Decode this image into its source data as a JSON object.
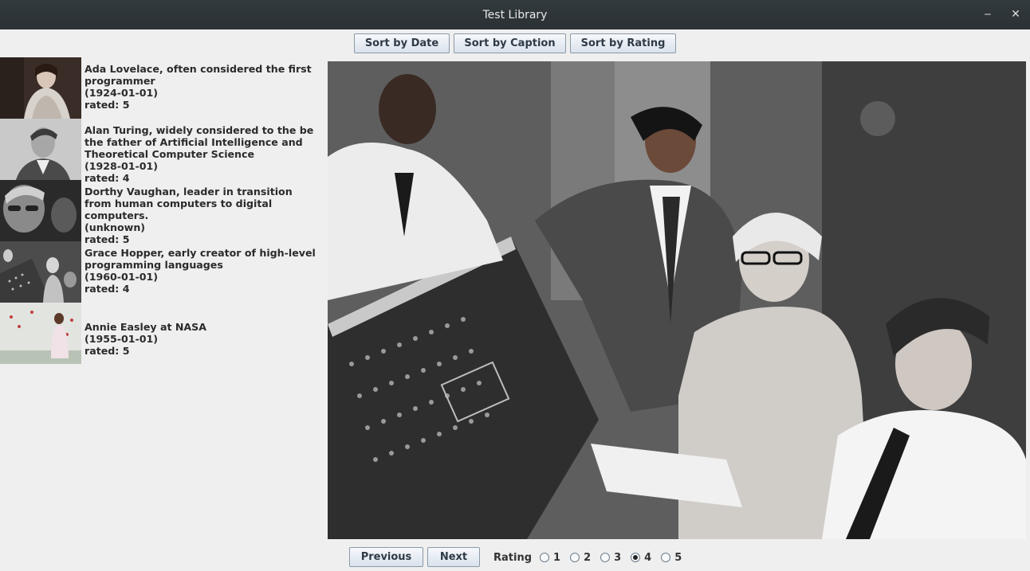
{
  "window": {
    "title": "Test Library",
    "minimize_glyph": "‒",
    "close_glyph": "✕"
  },
  "toolbar": {
    "sort_date": "Sort by Date",
    "sort_caption": "Sort by Caption",
    "sort_rating": "Sort by Rating"
  },
  "items": [
    {
      "caption": "Ada Lovelace, often considered the first programmer",
      "date": "(1924-01-01)",
      "rating": "rated: 5"
    },
    {
      "caption": "Alan Turing, widely considered to the be the father of Artificial Intelligence and Theoretical Computer Science",
      "date": "(1928-01-01)",
      "rating": "rated: 4"
    },
    {
      "caption": "Dorthy Vaughan, leader in transition from human computers to digital computers.",
      "date": "(unknown)",
      "rating": "rated: 5"
    },
    {
      "caption": "Grace Hopper, early creator of high-level programming languages",
      "date": "(1960-01-01)",
      "rating": "rated: 4"
    },
    {
      "caption": "Annie Easley at NASA",
      "date": "(1955-01-01)",
      "rating": "rated: 5"
    }
  ],
  "nav": {
    "previous": "Previous",
    "next": "Next"
  },
  "rating": {
    "label": "Rating",
    "options": [
      "1",
      "2",
      "3",
      "4",
      "5"
    ],
    "selected": "4"
  },
  "colors": {
    "titlebar": "#2f363a",
    "background": "#efefef",
    "button_border": "#8b99a8"
  }
}
